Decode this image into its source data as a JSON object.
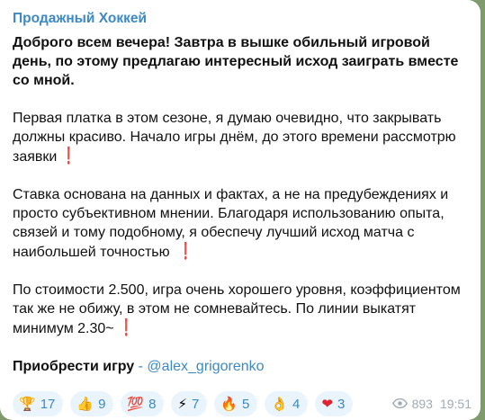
{
  "message": {
    "channel_name": "Продажный Хоккей",
    "headline": "Доброго всем вечера! Завтра в вышке обильный игровой день, по этому предлагаю интересный исход заиграть вместе со мной.",
    "paragraph_1": "Первая платка в этом сезоне, я думаю очевидно, что закрывать должны красиво. Начало игры днём, до этого времени рассмотрю заявки",
    "paragraph_2": "Ставка основана на данных и фактах, а не на предубеждениях и просто субъективном мнении. Благодаря использованию опыта, связей и тому подобному, я обеспечу лучший исход матча с наибольшей точностью",
    "paragraph_3": "По стоимости 2.500, игра очень хорошего уровня, коэффициентом так же не обижу, в этом не сомневайтесь. По линии выкатят минимум 2.30~",
    "cta_label": "Приобрести игру",
    "cta_separator": " - ",
    "cta_link": "@alex_grigorenko",
    "exclamation": "❗"
  },
  "reactions": [
    {
      "icon": "🏆",
      "icon_name": "trophy-icon",
      "count": "17"
    },
    {
      "icon": "👍",
      "icon_name": "thumbs-up-icon",
      "count": "9"
    },
    {
      "icon": "💯",
      "icon_name": "hundred-icon",
      "count": "8"
    },
    {
      "icon": "⚡",
      "icon_name": "lightning-icon",
      "count": "7"
    },
    {
      "icon": "🔥",
      "icon_name": "fire-icon",
      "count": "5"
    },
    {
      "icon": "👌",
      "icon_name": "ok-hand-icon",
      "count": "4"
    },
    {
      "icon": "❤",
      "icon_name": "heart-icon",
      "count": "3"
    }
  ],
  "meta": {
    "views": "893",
    "time": "19:51"
  },
  "colors": {
    "accent": "#3d89c5",
    "exclamation": "#e0232e",
    "reaction_bg": "#eaf4fc",
    "meta": "#a0abb5"
  }
}
